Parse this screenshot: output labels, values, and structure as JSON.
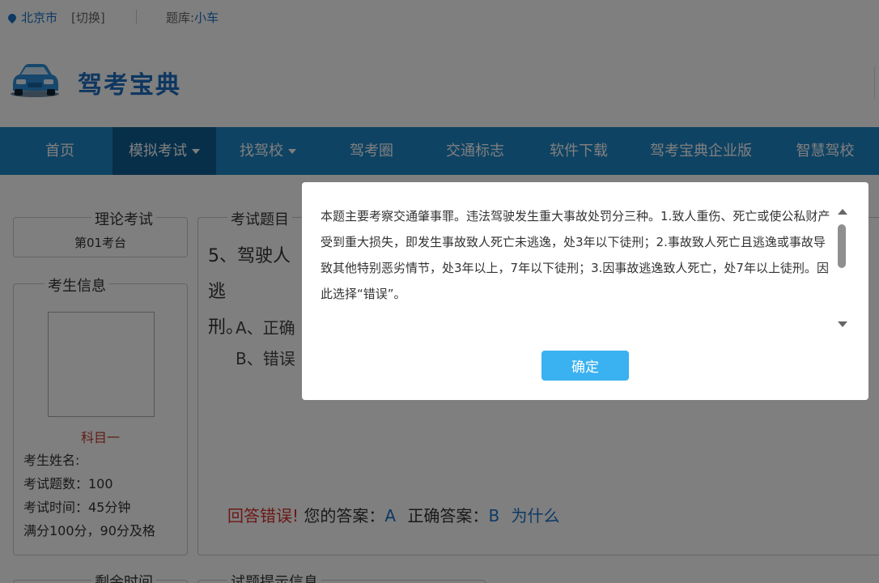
{
  "topbar": {
    "city": "北京市",
    "switch": "[切换]",
    "bank_label": "题库:",
    "bank_value": "小车"
  },
  "logo": {
    "brand": "驾考宝典"
  },
  "nav": {
    "items": [
      "首页",
      "模拟考试",
      "找驾校",
      "驾考圈",
      "交通标志",
      "软件下载",
      "驾考宝典企业版",
      "智慧驾校"
    ]
  },
  "exam": {
    "title_legend": "理论考试",
    "seat": "第01考台"
  },
  "student": {
    "legend": "考生信息",
    "subject": "科目一",
    "name_label": "考生姓名:",
    "count": "考试题数：100",
    "time": "考试时间：45分钟",
    "score": "满分100分，90分及格"
  },
  "question": {
    "legend": "考试题目",
    "text_line1": "5、驾驶人逃",
    "text_line2": "刑。",
    "option_a": "A、正确",
    "option_b": "B、错误",
    "result": "回答错误!",
    "your_label": "您的答案：",
    "your_value": "A",
    "correct_label": "正确答案：",
    "correct_value": "B",
    "why": "为什么"
  },
  "bottom": {
    "remain": "剩余时间",
    "tips": "试题提示信息"
  },
  "modal": {
    "explanation": "本题主要考察交通肇事罪。违法驾驶发生重大事故处罚分三种。1.致人重伤、死亡或使公私财产受到重大损失，即发生事故致人死亡未逃逸，处3年以下徒刑；2.事故致人死亡且逃逸或事故导致其他特别恶劣情节，处3年以上，7年以下徒刑；3.因事故逃逸致人死亡，处7年以上徒刑。因此选择“错误”。",
    "ok": "确定"
  },
  "colors": {
    "nav": "#1e86c6",
    "nav_active": "#0e5f94",
    "ok_button": "#3ab1f0",
    "error": "#d9302c"
  }
}
